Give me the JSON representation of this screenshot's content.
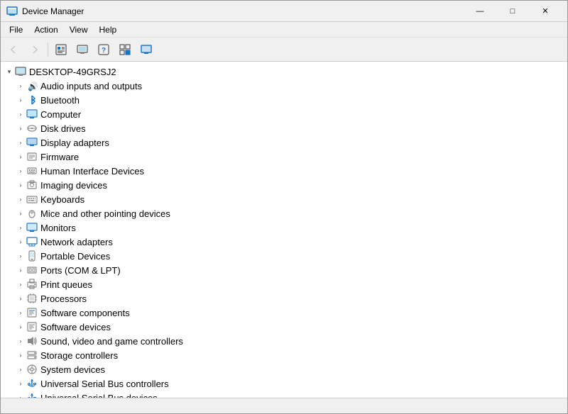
{
  "window": {
    "title": "Device Manager",
    "title_icon": "🖥",
    "controls": {
      "minimize": "—",
      "maximize": "□",
      "close": "✕"
    }
  },
  "menu": {
    "items": [
      {
        "label": "File"
      },
      {
        "label": "Action"
      },
      {
        "label": "View"
      },
      {
        "label": "Help"
      }
    ]
  },
  "toolbar": {
    "buttons": [
      {
        "icon": "◀",
        "label": "back",
        "disabled": false
      },
      {
        "icon": "▶",
        "label": "forward",
        "disabled": false
      },
      {
        "icon": "⊞",
        "label": "properties",
        "disabled": false
      },
      {
        "icon": "◫",
        "label": "update",
        "disabled": false
      },
      {
        "icon": "?",
        "label": "help",
        "disabled": false
      },
      {
        "icon": "⊡",
        "label": "view",
        "disabled": false
      },
      {
        "icon": "🖥",
        "label": "computer",
        "disabled": false
      }
    ]
  },
  "tree": {
    "root": {
      "label": "DESKTOP-49GRSJ2",
      "expanded": true
    },
    "items": [
      {
        "id": "audio",
        "label": "Audio inputs and outputs",
        "icon": "🔊",
        "iconClass": "icon-audio"
      },
      {
        "id": "bluetooth",
        "label": "Bluetooth",
        "icon": "⚡",
        "iconClass": "icon-bluetooth"
      },
      {
        "id": "computer",
        "label": "Computer",
        "icon": "🖥",
        "iconClass": "icon-monitor"
      },
      {
        "id": "disk",
        "label": "Disk drives",
        "icon": "💾",
        "iconClass": "icon-disk"
      },
      {
        "id": "display",
        "label": "Display adapters",
        "icon": "▦",
        "iconClass": "icon-display"
      },
      {
        "id": "firmware",
        "label": "Firmware",
        "icon": "▤",
        "iconClass": "icon-generic"
      },
      {
        "id": "hid",
        "label": "Human Interface Devices",
        "icon": "⌨",
        "iconClass": "icon-keyboard"
      },
      {
        "id": "imaging",
        "label": "Imaging devices",
        "icon": "📷",
        "iconClass": "icon-generic"
      },
      {
        "id": "keyboards",
        "label": "Keyboards",
        "icon": "⌨",
        "iconClass": "icon-keyboard"
      },
      {
        "id": "mice",
        "label": "Mice and other pointing devices",
        "icon": "🖱",
        "iconClass": "icon-mouse"
      },
      {
        "id": "monitors",
        "label": "Monitors",
        "icon": "🖥",
        "iconClass": "icon-monitor"
      },
      {
        "id": "network",
        "label": "Network adapters",
        "icon": "🌐",
        "iconClass": "icon-network"
      },
      {
        "id": "portable",
        "label": "Portable Devices",
        "icon": "📱",
        "iconClass": "icon-generic"
      },
      {
        "id": "ports",
        "label": "Ports (COM & LPT)",
        "icon": "▤",
        "iconClass": "icon-generic"
      },
      {
        "id": "print",
        "label": "Print queues",
        "icon": "🖨",
        "iconClass": "icon-print"
      },
      {
        "id": "processors",
        "label": "Processors",
        "icon": "▦",
        "iconClass": "icon-generic"
      },
      {
        "id": "software-comp",
        "label": "Software components",
        "icon": "▤",
        "iconClass": "icon-generic"
      },
      {
        "id": "software-dev",
        "label": "Software devices",
        "icon": "▤",
        "iconClass": "icon-generic"
      },
      {
        "id": "sound",
        "label": "Sound, video and game controllers",
        "icon": "🔊",
        "iconClass": "icon-audio"
      },
      {
        "id": "storage",
        "label": "Storage controllers",
        "icon": "💾",
        "iconClass": "icon-storage"
      },
      {
        "id": "system",
        "label": "System devices",
        "icon": "⚙",
        "iconClass": "icon-generic"
      },
      {
        "id": "usb",
        "label": "Universal Serial Bus controllers",
        "icon": "⚡",
        "iconClass": "icon-usb"
      },
      {
        "id": "usb-dev",
        "label": "Universal Serial Bus devices",
        "icon": "⚡",
        "iconClass": "icon-usb"
      }
    ]
  },
  "status": ""
}
